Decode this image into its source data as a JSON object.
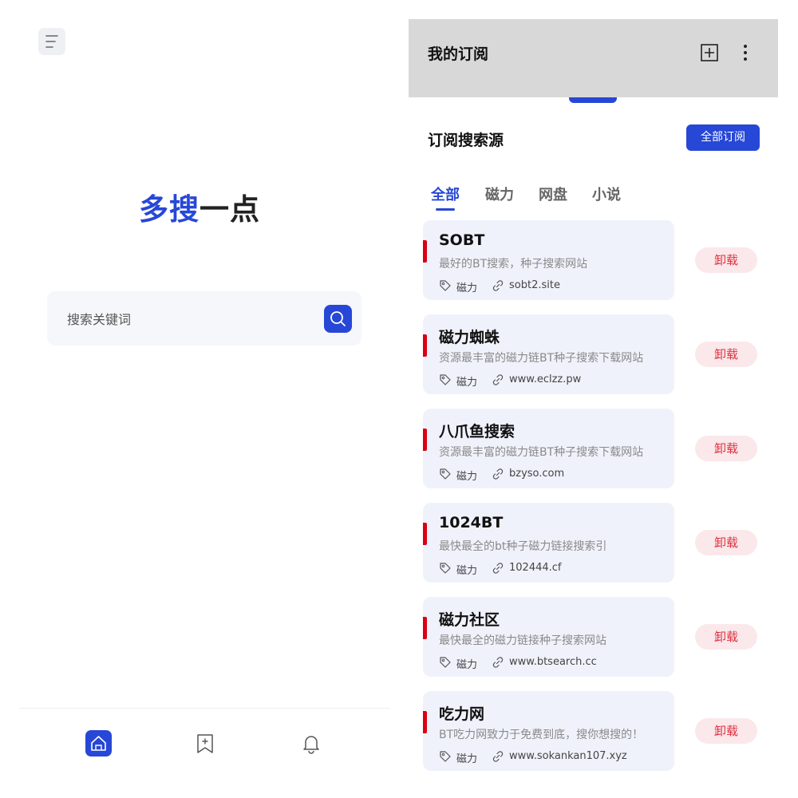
{
  "left": {
    "logo_part1": "多搜",
    "logo_part2": "一点",
    "search_placeholder": "搜索关键词",
    "icons": {
      "menu": "menu-lines-icon",
      "search": "search-icon",
      "home": "home-icon",
      "bookmark": "bookmark-add-icon",
      "bell": "bell-icon"
    }
  },
  "right": {
    "title": "我的订阅",
    "section_title": "订阅搜索源",
    "subscribe_all": "全部订阅",
    "tabs": [
      "全部",
      "磁力",
      "网盘",
      "小说"
    ],
    "active_tab": 0,
    "uninstall_label": "卸载",
    "sources": [
      {
        "title": "SOBT",
        "desc": "最好的BT搜索，种子搜索网站",
        "category": "磁力",
        "url": "sobt2.site"
      },
      {
        "title": "磁力蜘蛛",
        "desc": "资源最丰富的磁力链BT种子搜索下载网站",
        "category": "磁力",
        "url": "www.eclzz.pw"
      },
      {
        "title": "八爪鱼搜索",
        "desc": "资源最丰富的磁力链BT种子搜索下载网站",
        "category": "磁力",
        "url": "bzyso.com"
      },
      {
        "title": "1024BT",
        "desc": "最快最全的bt种子磁力链接搜索引",
        "category": "磁力",
        "url": "102444.cf"
      },
      {
        "title": "磁力社区",
        "desc": "最快最全的磁力链接种子搜索网站",
        "category": "磁力",
        "url": "www.btsearch.cc"
      },
      {
        "title": "吃力网",
        "desc": "BT吃力网致力于免费到底，搜你想搜的！",
        "category": "磁力",
        "url": "www.sokankan107.xyz"
      }
    ]
  },
  "colors": {
    "accent": "#2747d6",
    "danger": "#e0303f",
    "danger_bg": "#fbe8ea",
    "card_bg": "#f0f2fb",
    "card_marker": "#d90012"
  }
}
